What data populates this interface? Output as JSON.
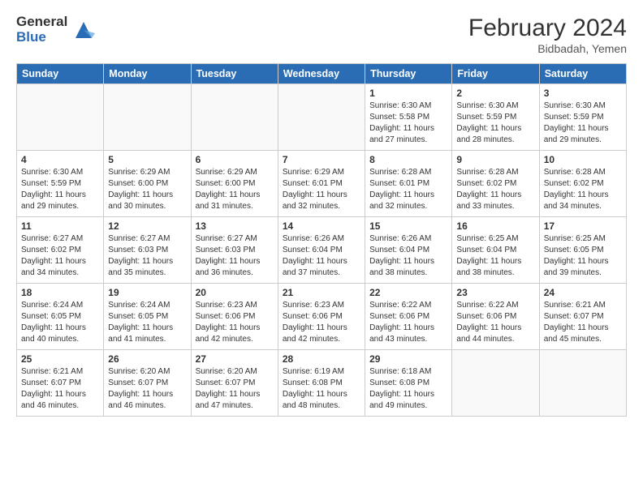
{
  "header": {
    "logo_general": "General",
    "logo_blue": "Blue",
    "title": "February 2024",
    "location": "Bidbadah, Yemen"
  },
  "days_of_week": [
    "Sunday",
    "Monday",
    "Tuesday",
    "Wednesday",
    "Thursday",
    "Friday",
    "Saturday"
  ],
  "weeks": [
    [
      null,
      null,
      null,
      null,
      {
        "num": "1",
        "sunrise": "6:30 AM",
        "sunset": "5:58 PM",
        "daylight": "11 hours and 27 minutes."
      },
      {
        "num": "2",
        "sunrise": "6:30 AM",
        "sunset": "5:59 PM",
        "daylight": "11 hours and 28 minutes."
      },
      {
        "num": "3",
        "sunrise": "6:30 AM",
        "sunset": "5:59 PM",
        "daylight": "11 hours and 29 minutes."
      }
    ],
    [
      {
        "num": "4",
        "sunrise": "6:30 AM",
        "sunset": "5:59 PM",
        "daylight": "11 hours and 29 minutes."
      },
      {
        "num": "5",
        "sunrise": "6:29 AM",
        "sunset": "6:00 PM",
        "daylight": "11 hours and 30 minutes."
      },
      {
        "num": "6",
        "sunrise": "6:29 AM",
        "sunset": "6:00 PM",
        "daylight": "11 hours and 31 minutes."
      },
      {
        "num": "7",
        "sunrise": "6:29 AM",
        "sunset": "6:01 PM",
        "daylight": "11 hours and 32 minutes."
      },
      {
        "num": "8",
        "sunrise": "6:28 AM",
        "sunset": "6:01 PM",
        "daylight": "11 hours and 32 minutes."
      },
      {
        "num": "9",
        "sunrise": "6:28 AM",
        "sunset": "6:02 PM",
        "daylight": "11 hours and 33 minutes."
      },
      {
        "num": "10",
        "sunrise": "6:28 AM",
        "sunset": "6:02 PM",
        "daylight": "11 hours and 34 minutes."
      }
    ],
    [
      {
        "num": "11",
        "sunrise": "6:27 AM",
        "sunset": "6:02 PM",
        "daylight": "11 hours and 34 minutes."
      },
      {
        "num": "12",
        "sunrise": "6:27 AM",
        "sunset": "6:03 PM",
        "daylight": "11 hours and 35 minutes."
      },
      {
        "num": "13",
        "sunrise": "6:27 AM",
        "sunset": "6:03 PM",
        "daylight": "11 hours and 36 minutes."
      },
      {
        "num": "14",
        "sunrise": "6:26 AM",
        "sunset": "6:04 PM",
        "daylight": "11 hours and 37 minutes."
      },
      {
        "num": "15",
        "sunrise": "6:26 AM",
        "sunset": "6:04 PM",
        "daylight": "11 hours and 38 minutes."
      },
      {
        "num": "16",
        "sunrise": "6:25 AM",
        "sunset": "6:04 PM",
        "daylight": "11 hours and 38 minutes."
      },
      {
        "num": "17",
        "sunrise": "6:25 AM",
        "sunset": "6:05 PM",
        "daylight": "11 hours and 39 minutes."
      }
    ],
    [
      {
        "num": "18",
        "sunrise": "6:24 AM",
        "sunset": "6:05 PM",
        "daylight": "11 hours and 40 minutes."
      },
      {
        "num": "19",
        "sunrise": "6:24 AM",
        "sunset": "6:05 PM",
        "daylight": "11 hours and 41 minutes."
      },
      {
        "num": "20",
        "sunrise": "6:23 AM",
        "sunset": "6:06 PM",
        "daylight": "11 hours and 42 minutes."
      },
      {
        "num": "21",
        "sunrise": "6:23 AM",
        "sunset": "6:06 PM",
        "daylight": "11 hours and 42 minutes."
      },
      {
        "num": "22",
        "sunrise": "6:22 AM",
        "sunset": "6:06 PM",
        "daylight": "11 hours and 43 minutes."
      },
      {
        "num": "23",
        "sunrise": "6:22 AM",
        "sunset": "6:06 PM",
        "daylight": "11 hours and 44 minutes."
      },
      {
        "num": "24",
        "sunrise": "6:21 AM",
        "sunset": "6:07 PM",
        "daylight": "11 hours and 45 minutes."
      }
    ],
    [
      {
        "num": "25",
        "sunrise": "6:21 AM",
        "sunset": "6:07 PM",
        "daylight": "11 hours and 46 minutes."
      },
      {
        "num": "26",
        "sunrise": "6:20 AM",
        "sunset": "6:07 PM",
        "daylight": "11 hours and 46 minutes."
      },
      {
        "num": "27",
        "sunrise": "6:20 AM",
        "sunset": "6:07 PM",
        "daylight": "11 hours and 47 minutes."
      },
      {
        "num": "28",
        "sunrise": "6:19 AM",
        "sunset": "6:08 PM",
        "daylight": "11 hours and 48 minutes."
      },
      {
        "num": "29",
        "sunrise": "6:18 AM",
        "sunset": "6:08 PM",
        "daylight": "11 hours and 49 minutes."
      },
      null,
      null
    ]
  ]
}
